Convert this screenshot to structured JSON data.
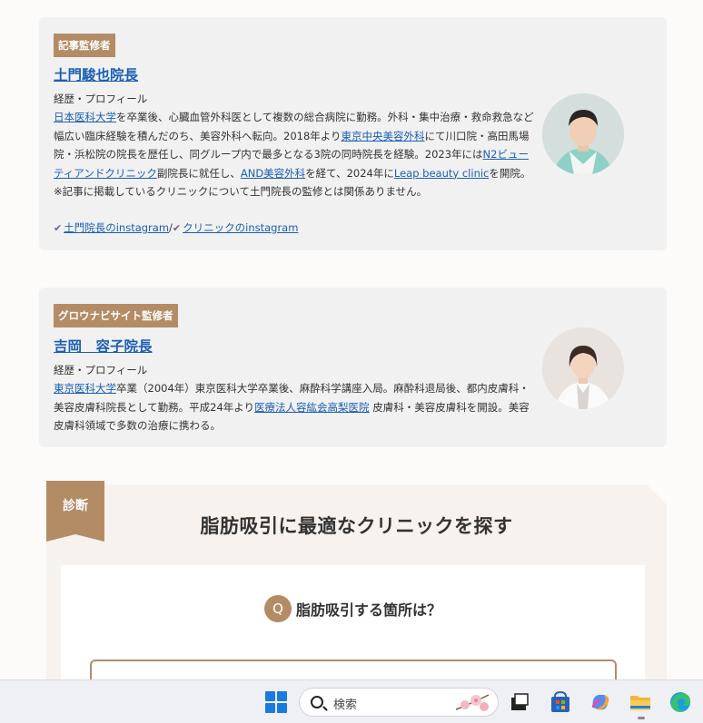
{
  "supervisor1": {
    "tag": "記事監修者",
    "name": "土門駿也院長",
    "profile_label": "経歴・プロフィール",
    "bio": [
      {
        "t": "日本医科大学",
        "link": true
      },
      {
        "t": "を卒業後、心臓血管外科医として複数の総合病院に勤務。外科・集中治療・救命救急など幅広い臨床経験を積んだのち、美容外科へ転向。2018年より",
        "link": false
      },
      {
        "t": "東京中央美容外科",
        "link": true
      },
      {
        "t": "にて川口院・高田馬場院・浜松院の院長を歴任し、同グループ内で最多となる3院の同時院長を経験。2023年には",
        "link": false
      },
      {
        "t": "N2ビューティアンドクリニック",
        "link": true
      },
      {
        "t": "副院長に就任し、",
        "link": false
      },
      {
        "t": "AND美容外科",
        "link": true
      },
      {
        "t": "を経て、2024年に",
        "link": false
      },
      {
        "t": "Leap beauty clinic",
        "link": true
      },
      {
        "t": "を開院。",
        "link": false
      }
    ],
    "note": "※記事に掲載しているクリニックについて土門院長の監修とは関係ありません。",
    "sns_doctor": "土門院長のinstagram",
    "sns_sep": "/",
    "sns_clinic": "クリニックのinstagram",
    "check_glyph": "✔"
  },
  "supervisor2": {
    "tag": "グロウナビサイト監修者",
    "name": "吉岡　容子院長",
    "profile_label": "経歴・プロフィール",
    "bio": [
      {
        "t": "東京医科大学",
        "link": true
      },
      {
        "t": "卒業（2004年）東京医科大学卒業後、麻酔科学講座入局。麻酔科退局後、都内皮膚科・美容皮膚科院長として勤務。平成24年より",
        "link": false
      },
      {
        "t": "医療法人容紘会高梨医院",
        "link": true
      },
      {
        "t": " 皮膚科・美容皮膚科を開設。美容皮膚科領域で多数の治療に携わる。",
        "link": false
      }
    ]
  },
  "diagnosis": {
    "ribbon": "診断",
    "title": "脂肪吸引に最適なクリニックを探す",
    "q_badge": "Q",
    "question": "脂肪吸引する箇所は？"
  },
  "taskbar": {
    "search_placeholder": "検索",
    "apps": [
      "task-view-icon",
      "store-icon",
      "copilot-icon",
      "file-explorer-icon",
      "edge-icon"
    ]
  },
  "colors": {
    "accent": "#b38c66",
    "link": "#1a5fb4",
    "card_bg": "#f1f1f1"
  }
}
